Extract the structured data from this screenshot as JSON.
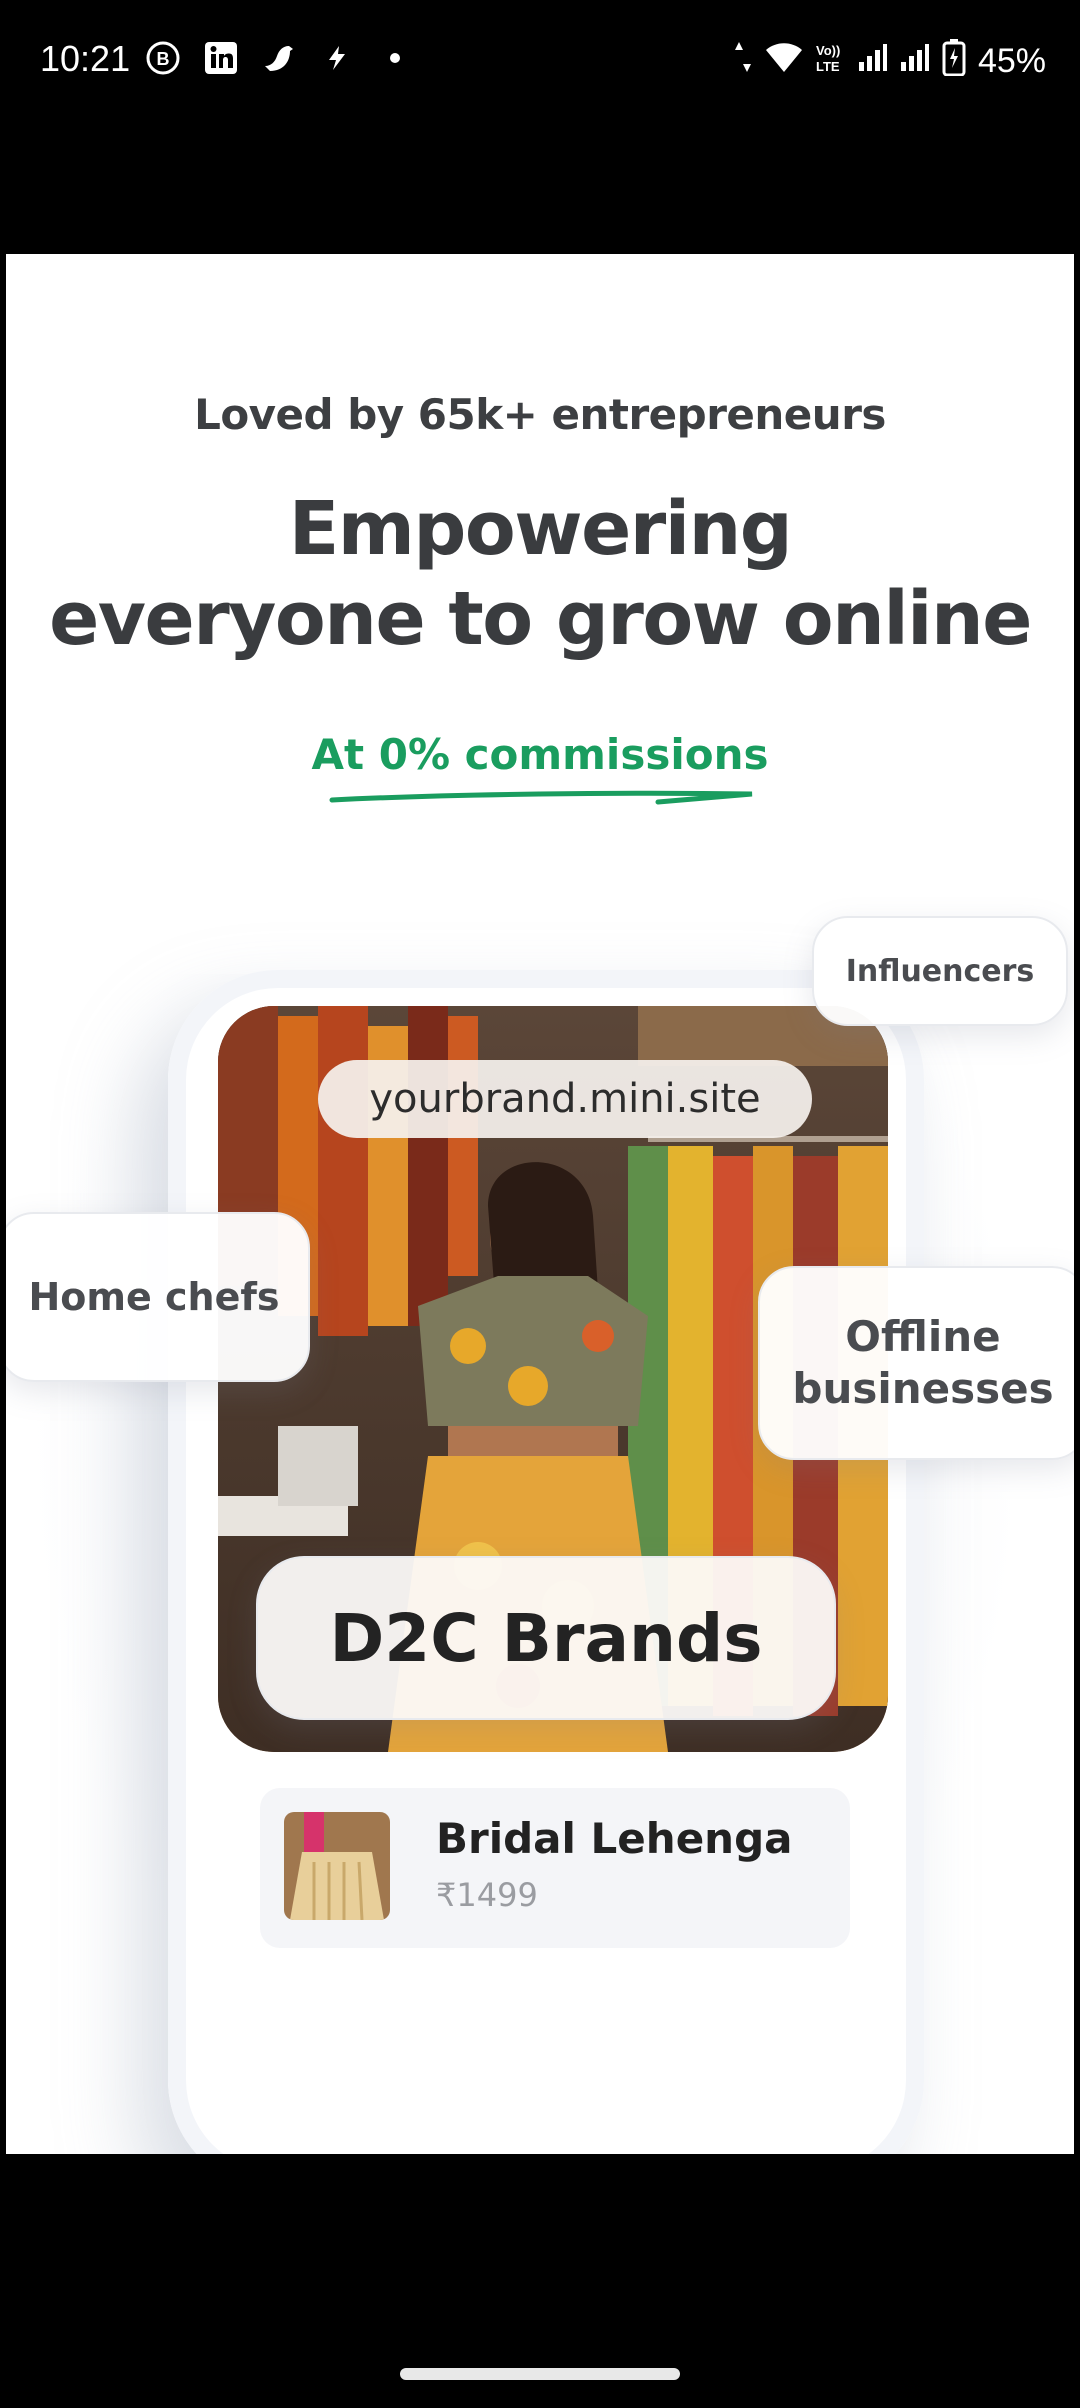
{
  "status_bar": {
    "time": "10:21",
    "battery": "45%",
    "left_icons": [
      "b-circle-icon",
      "linkedin-icon",
      "bird-icon",
      "flash-icon",
      "dot-icon"
    ],
    "right_icons": [
      "data-arrows-icon",
      "wifi-icon",
      "volte-icon",
      "signal-icon",
      "signal-icon",
      "battery-icon"
    ]
  },
  "hero": {
    "tagline": "Loved by 65k+ entrepreneurs",
    "headline_line1": "Empowering",
    "headline_line2": "everyone to grow online",
    "commission": "At 0% commissions",
    "accent_color": "#1a9d5f"
  },
  "mockup": {
    "url": "yourbrand.mini.site",
    "chips": {
      "influencers": "Influencers",
      "home_chefs": "Home chefs",
      "offline_line1": "Offline",
      "offline_line2": "businesses",
      "d2c": "D2C Brands"
    },
    "product": {
      "name": "Bridal Lehenga",
      "price": "₹1499"
    }
  }
}
